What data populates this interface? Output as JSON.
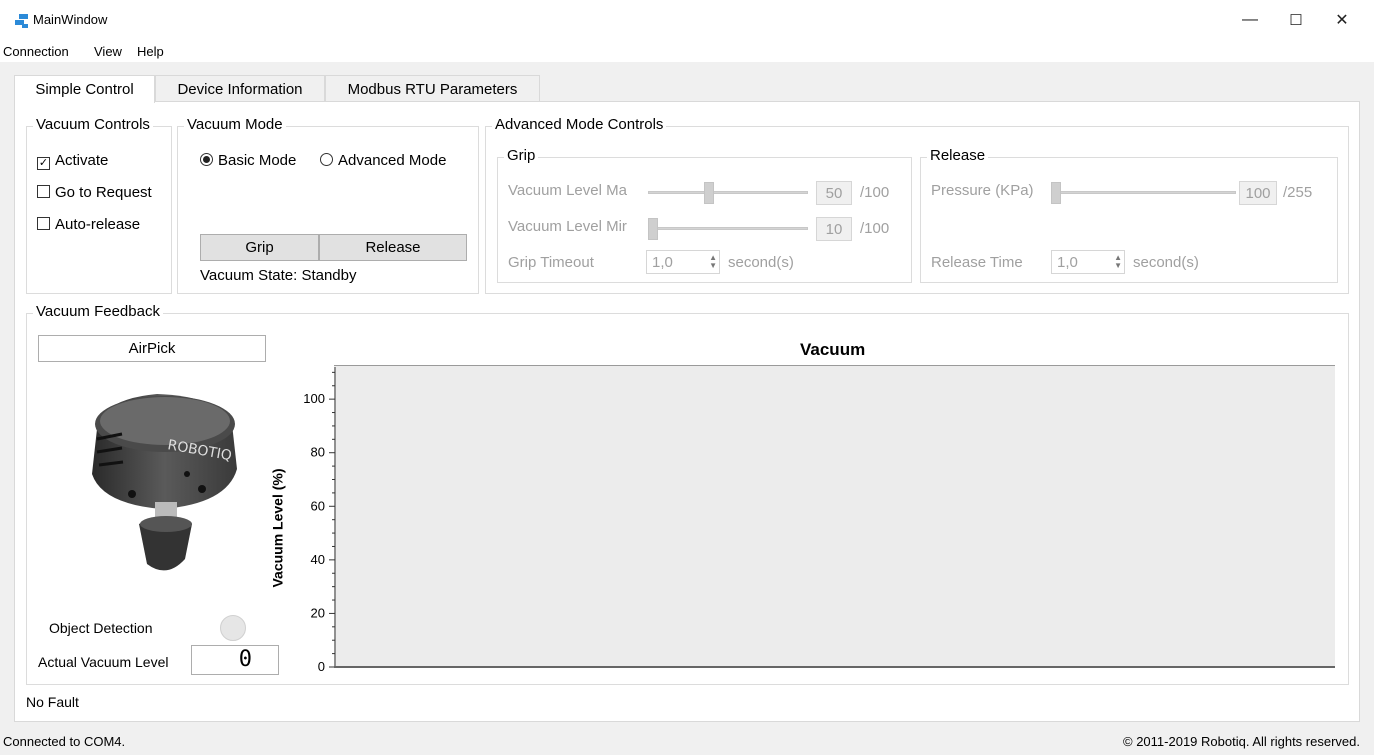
{
  "window": {
    "title": "MainWindow",
    "minimize": "—",
    "maximize": "☐",
    "close": "✕"
  },
  "menu": [
    "Connection",
    "View",
    "Help"
  ],
  "tabs": [
    "Simple Control",
    "Device Information",
    "Modbus RTU Parameters"
  ],
  "vacuum_controls": {
    "title": "Vacuum Controls",
    "activate": {
      "label": "Activate",
      "checked": true
    },
    "go_to_request": {
      "label": "Go to Request",
      "checked": false
    },
    "auto_release": {
      "label": "Auto-release",
      "checked": false
    }
  },
  "vacuum_mode": {
    "title": "Vacuum Mode",
    "basic": "Basic Mode",
    "advanced": "Advanced Mode",
    "grip_button": "Grip",
    "release_button": "Release",
    "state": "Vacuum State: Standby"
  },
  "advanced": {
    "title": "Advanced Mode Controls",
    "grip": {
      "title": "Grip",
      "max_label": "Vacuum Level Ma",
      "max_value": "50",
      "max_of": "/100",
      "min_label": "Vacuum Level Mir",
      "min_value": "10",
      "min_of": "/100",
      "timeout_label": "Grip Timeout",
      "timeout_value": "1,0",
      "timeout_unit": "second(s)"
    },
    "release": {
      "title": "Release",
      "pressure_label": "Pressure (KPa)",
      "pressure_value": "100",
      "pressure_of": "/255",
      "time_label": "Release Time",
      "time_value": "1,0",
      "time_unit": "second(s)"
    }
  },
  "feedback": {
    "title": "Vacuum Feedback",
    "device": "AirPick",
    "object_detection": "Object Detection",
    "actual_vacuum_label": "Actual Vacuum Level",
    "actual_vacuum_value": "0",
    "logo_text": "ROBOTIQ"
  },
  "fault": "No Fault",
  "status": {
    "left": "Connected to COM4.",
    "right": "© 2011-2019 Robotiq. All rights reserved."
  },
  "chart_data": {
    "type": "line",
    "title": "Vacuum",
    "xlabel": "",
    "ylabel": "Vacuum Level (%)",
    "ylim": [
      0,
      112
    ],
    "yticks": [
      "0",
      "20",
      "40",
      "60",
      "80",
      "100"
    ],
    "series": [
      {
        "values": []
      }
    ],
    "grid": false
  }
}
